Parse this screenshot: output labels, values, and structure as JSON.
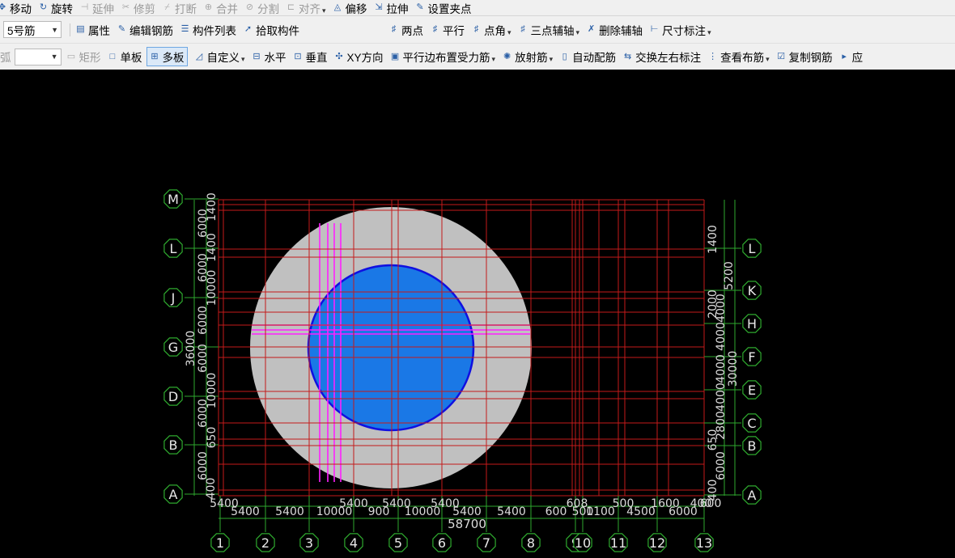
{
  "toolbar_row1": [
    {
      "id": "move",
      "label": "移动",
      "icon": "move-icon",
      "enabled": true
    },
    {
      "id": "rotate",
      "label": "旋转",
      "icon": "rotate-icon",
      "enabled": true
    },
    {
      "id": "extend",
      "label": "延伸",
      "icon": "extend-icon",
      "enabled": false
    },
    {
      "id": "trim",
      "label": "修剪",
      "icon": "trim-icon",
      "enabled": false
    },
    {
      "id": "break",
      "label": "打断",
      "icon": "break-icon",
      "enabled": false
    },
    {
      "id": "merge",
      "label": "合并",
      "icon": "merge-icon",
      "enabled": false
    },
    {
      "id": "split",
      "label": "分割",
      "icon": "split-icon",
      "enabled": false
    },
    {
      "id": "align",
      "label": "对齐",
      "icon": "align-icon",
      "enabled": false,
      "dropdown": true
    },
    {
      "id": "offset",
      "label": "偏移",
      "icon": "offset-icon",
      "enabled": true
    },
    {
      "id": "stretch",
      "label": "拉伸",
      "icon": "stretch-icon",
      "enabled": true
    },
    {
      "id": "setpoint",
      "label": "设置夹点",
      "icon": "grip-point-icon",
      "enabled": true
    }
  ],
  "toolbar_row2": {
    "rebar_select": "5号筋",
    "left_items": [
      {
        "id": "properties",
        "label": "属性",
        "icon": "properties-icon"
      },
      {
        "id": "edit_rebar",
        "label": "编辑钢筋",
        "icon": "edit-rebar-icon"
      },
      {
        "id": "component_list",
        "label": "构件列表",
        "icon": "component-list-icon"
      },
      {
        "id": "pick",
        "label": "拾取构件",
        "icon": "pick-icon"
      }
    ],
    "right_items": [
      {
        "id": "two_point",
        "label": "两点",
        "icon": "two-point-axis-icon"
      },
      {
        "id": "parallel",
        "label": "平行",
        "icon": "parallel-axis-icon"
      },
      {
        "id": "point_angle",
        "label": "点角",
        "icon": "point-angle-icon",
        "dropdown": true
      },
      {
        "id": "three_point",
        "label": "三点辅轴",
        "icon": "three-point-axis-icon",
        "dropdown": true
      },
      {
        "id": "delete_axis",
        "label": "删除辅轴",
        "icon": "delete-axis-icon"
      },
      {
        "id": "dimension",
        "label": "尺寸标注",
        "icon": "dimension-icon",
        "dropdown": true
      }
    ]
  },
  "toolbar_row3": {
    "arc_label": "弧",
    "arc_select": "",
    "items": [
      {
        "id": "rect",
        "label": "矩形",
        "icon": "rectangle-icon",
        "enabled": false
      },
      {
        "id": "single_slab",
        "label": "单板",
        "icon": "single-slab-icon",
        "enabled": true
      },
      {
        "id": "multi_slab",
        "label": "多板",
        "icon": "multi-slab-icon",
        "enabled": true,
        "active": true
      },
      {
        "id": "custom",
        "label": "自定义",
        "icon": "custom-icon",
        "enabled": true,
        "dropdown": true
      },
      {
        "id": "horizontal",
        "label": "水平",
        "icon": "horizontal-icon",
        "enabled": true
      },
      {
        "id": "vertical",
        "label": "垂直",
        "icon": "vertical-icon",
        "enabled": true
      },
      {
        "id": "xy_dir",
        "label": "XY方向",
        "icon": "xy-direction-icon",
        "enabled": true
      },
      {
        "id": "parallel_edge",
        "label": "平行边布置受力筋",
        "icon": "parallel-edge-icon",
        "enabled": true,
        "dropdown": true
      },
      {
        "id": "radial",
        "label": "放射筋",
        "icon": "radial-rebar-icon",
        "enabled": true,
        "dropdown": true
      },
      {
        "id": "auto_rebar",
        "label": "自动配筋",
        "icon": "auto-rebar-icon",
        "enabled": true
      },
      {
        "id": "swap_labels",
        "label": "交换左右标注",
        "icon": "swap-labels-icon",
        "enabled": true
      },
      {
        "id": "view_layout",
        "label": "查看布筋",
        "icon": "view-layout-icon",
        "enabled": true,
        "dropdown": true
      },
      {
        "id": "copy_rebar",
        "label": "复制钢筋",
        "icon": "copy-rebar-icon",
        "enabled": true
      },
      {
        "id": "more",
        "label": "应",
        "icon": "more-icon",
        "enabled": true
      }
    ]
  },
  "grid": {
    "bottom_axes": [
      "1",
      "2",
      "3",
      "4",
      "5",
      "6",
      "7",
      "8",
      "9",
      "10",
      "11",
      "12",
      "13"
    ],
    "left_axes": [
      "A",
      "B",
      "D",
      "G",
      "J",
      "L",
      "M"
    ],
    "right_axes": [
      "A",
      "B",
      "C",
      "E",
      "F",
      "H",
      "K",
      "L"
    ],
    "bottom_dims": [
      {
        "t": "5400"
      },
      {
        "t": "5400"
      },
      {
        "t": "5400"
      },
      {
        "t": "10000"
      },
      {
        "t": "5400"
      },
      {
        "t": "900"
      },
      {
        "t": "5400"
      },
      {
        "t": "10000"
      },
      {
        "t": "5400"
      },
      {
        "t": "5400"
      },
      {
        "t": "5400"
      },
      {
        "t": "600"
      },
      {
        "t": "608"
      },
      {
        "t": "500"
      },
      {
        "t": "1100"
      },
      {
        "t": "500"
      },
      {
        "t": "4500"
      },
      {
        "t": "1600"
      },
      {
        "t": "6000"
      },
      {
        "t": "400"
      },
      {
        "t": "600"
      }
    ],
    "bottom_total": "58700",
    "left_dims": [
      {
        "t": "400"
      },
      {
        "t": "6000"
      },
      {
        "t": "650"
      },
      {
        "t": "6000"
      },
      {
        "t": "10000"
      },
      {
        "t": "6000"
      },
      {
        "t": "36000"
      },
      {
        "t": "6000"
      },
      {
        "t": "10000"
      },
      {
        "t": "6000"
      },
      {
        "t": "1400"
      },
      {
        "t": "6000"
      },
      {
        "t": "1400"
      }
    ],
    "right_dims": [
      {
        "t": "400"
      },
      {
        "t": "6000"
      },
      {
        "t": "650"
      },
      {
        "t": "2800"
      },
      {
        "t": "4000"
      },
      {
        "t": "4000"
      },
      {
        "t": "30000"
      },
      {
        "t": "4000"
      },
      {
        "t": "4000"
      },
      {
        "t": "2000"
      },
      {
        "t": "5200"
      },
      {
        "t": "1400"
      }
    ]
  },
  "colors": {
    "grid_line": "#c41a1a",
    "axis_green": "#2ea82e",
    "dim_text": "#dcdcdc",
    "outer_slab": "#c0c0c0",
    "inner_slab": "#1a78e6",
    "inner_edge": "#1010e0",
    "rebar": "#ff20ff"
  }
}
